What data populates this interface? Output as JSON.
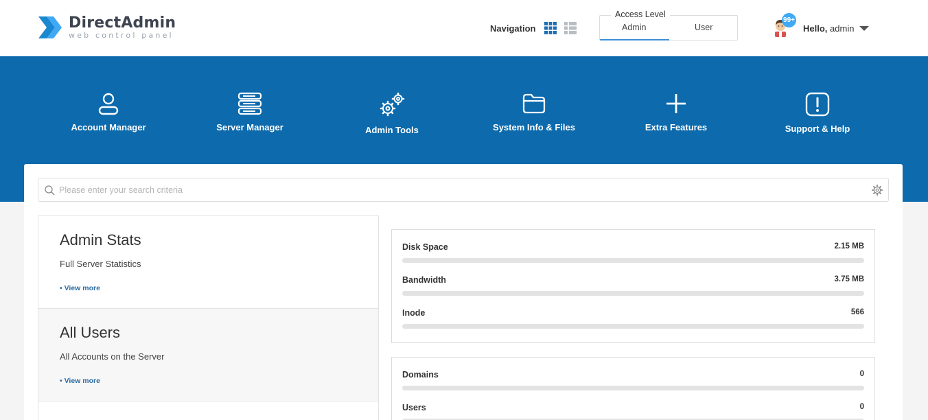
{
  "logo": {
    "title": "DirectAdmin",
    "subtitle": "web control panel"
  },
  "header": {
    "navigation_label": "Navigation",
    "access_level": {
      "legend": "Access Level",
      "options": [
        "Admin",
        "User"
      ],
      "selected": "Admin"
    },
    "notifications_badge": "99+",
    "greeting": "Hello,",
    "username": "admin"
  },
  "categories": [
    {
      "label": "Account Manager",
      "icon": "user-icon"
    },
    {
      "label": "Server Manager",
      "icon": "server-icon"
    },
    {
      "label": "Admin Tools",
      "icon": "gears-icon"
    },
    {
      "label": "System Info & Files",
      "icon": "folder-icon"
    },
    {
      "label": "Extra Features",
      "icon": "plus-icon"
    },
    {
      "label": "Support & Help",
      "icon": "exclamation-icon"
    }
  ],
  "search": {
    "placeholder": "Please enter your search criteria"
  },
  "stats": [
    {
      "title": "Admin Stats",
      "description": "Full Server Statistics",
      "link": "• View more"
    },
    {
      "title": "All Users",
      "description": "All Accounts on the Server",
      "link": "• View more"
    }
  ],
  "usage": [
    {
      "name": "Disk Space",
      "value": "2.15 MB",
      "fill": 0
    },
    {
      "name": "Bandwidth",
      "value": "3.75 MB",
      "fill": 0
    },
    {
      "name": "Inode",
      "value": "566",
      "fill": 0
    }
  ],
  "counts": [
    {
      "name": "Domains",
      "value": "0",
      "fill": 0
    },
    {
      "name": "Users",
      "value": "0",
      "fill": 0
    }
  ],
  "colors": {
    "brand_blue": "#0c6aad",
    "accent": "#3a8fd6",
    "badge": "#3fa9f5"
  }
}
